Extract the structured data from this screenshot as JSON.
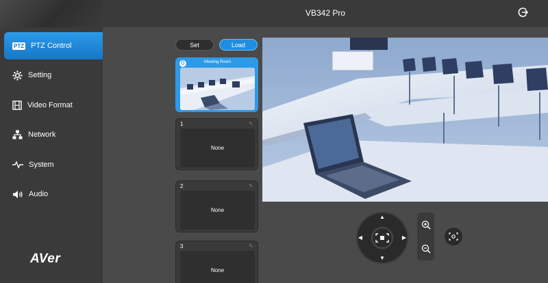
{
  "header": {
    "title": "VB342 Pro",
    "logout_icon": "logout-icon"
  },
  "sidebar": {
    "items": [
      {
        "label": "PTZ Control",
        "icon": "ptz-icon",
        "badge": "PTZ",
        "active": true
      },
      {
        "label": "Setting",
        "icon": "gear-icon"
      },
      {
        "label": "Video Format",
        "icon": "film-icon"
      },
      {
        "label": "Network",
        "icon": "network-icon"
      },
      {
        "label": "System",
        "icon": "pulse-icon"
      },
      {
        "label": "Audio",
        "icon": "speaker-icon"
      }
    ],
    "logo": "AVer"
  },
  "presets": {
    "set_label": "Set",
    "load_label": "Load",
    "list": [
      {
        "num": "0",
        "name": "Meeting Room",
        "content": ""
      },
      {
        "num": "1",
        "name": "",
        "content": "None"
      },
      {
        "num": "2",
        "name": "",
        "content": "None"
      },
      {
        "num": "3",
        "name": "",
        "content": "None"
      }
    ]
  },
  "controls": {
    "up": "up-arrow-icon",
    "down": "down-arrow-icon",
    "left": "left-arrow-icon",
    "right": "right-arrow-icon",
    "home": "home-icon",
    "zoom_in": "zoom-in-icon",
    "zoom_out": "zoom-out-icon",
    "focus": "focus-icon"
  },
  "colors": {
    "accent": "#2b9ae8",
    "sidebar": "#3a3a3a",
    "content": "#4a4a4a"
  }
}
